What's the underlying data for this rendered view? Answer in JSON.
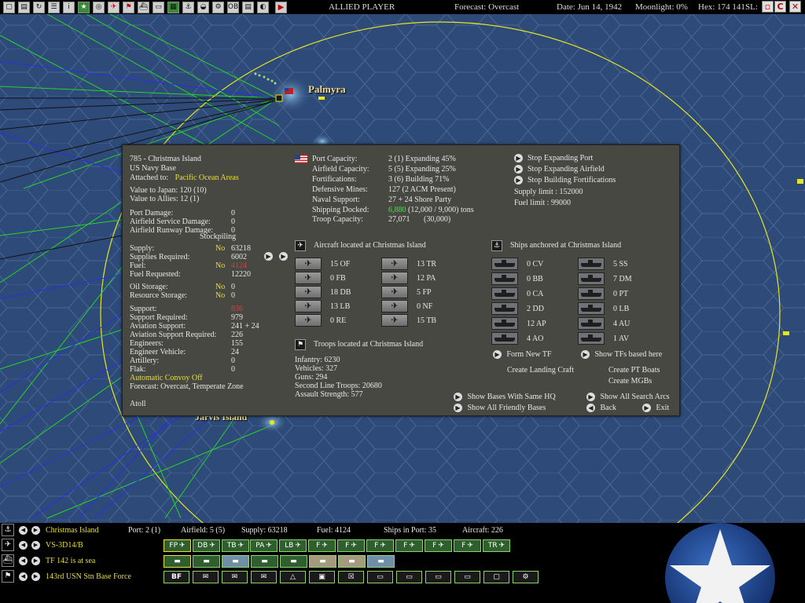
{
  "topbar": {
    "icons": [
      "square-icon",
      "doc-icon",
      "refresh-icon",
      "list-icon",
      "info-icon",
      "star-icon",
      "globe-icon",
      "plane-icon",
      "flag-icon",
      "ship-icon",
      "truck-icon",
      "map-icon",
      "harbor-icon",
      "submarine-icon",
      "settings-icon",
      "ob-icon",
      "page-icon",
      "moon-icon"
    ],
    "title": "ALLIED PLAYER",
    "forecast": "Forecast: Overcast",
    "date": "Date: Jun 14, 1942",
    "moonlight": "Moonlight: 0%",
    "hex": "Hex: 174 141",
    "sl": "SL:"
  },
  "map": {
    "labels": {
      "palmyra": "Palmyra",
      "jarvis": "Jarvis Island"
    },
    "colors": {
      "ocean": "#2d4a78",
      "hex_line": "#4a6794",
      "range_circle": "#e6e61e",
      "green_line": "#28d428",
      "blue_line": "#2830e6"
    }
  },
  "panel": {
    "header": {
      "name": "785 - Christmas Island",
      "type": "US Navy Base",
      "attached_label": "Attached to:",
      "attached_value": "Pacific Ocean Areas",
      "value_japan": "Value to Japan: 120 (10)",
      "value_allies": "Value to Allies: 12 (1)"
    },
    "damage": [
      {
        "label": "Port Damage:",
        "value": "0"
      },
      {
        "label": "Airfield Service Damage:",
        "value": "0"
      },
      {
        "label": "Airfield Runway Damage:",
        "value": "0"
      }
    ],
    "stockpiling": "Stockpiling",
    "supply": [
      {
        "label": "Supply:",
        "flag": "No",
        "value": "63218",
        "value_color": ""
      },
      {
        "label": "Supplies Required:",
        "flag": "",
        "value": "6002",
        "value_color": ""
      },
      {
        "label": "Fuel:",
        "flag": "No",
        "value": "4124",
        "value_color": "red"
      },
      {
        "label": "Fuel Requested:",
        "flag": "",
        "value": "12220",
        "value_color": ""
      }
    ],
    "storage": [
      {
        "label": "Oil Storage:",
        "flag": "No",
        "value": "0"
      },
      {
        "label": "Resource Storage:",
        "flag": "No",
        "value": "0"
      }
    ],
    "support": [
      {
        "label": "Support:",
        "value": "836",
        "value_color": "red"
      },
      {
        "label": "Support Required:",
        "value": "979",
        "value_color": ""
      },
      {
        "label": "Aviation Support:",
        "value": "241 + 24",
        "value_color": ""
      },
      {
        "label": "Aviation Support Required:",
        "value": "226",
        "value_color": ""
      },
      {
        "label": "Engineers:",
        "value": "155",
        "value_color": ""
      },
      {
        "label": "Engineer Vehicle:",
        "value": "24",
        "value_color": ""
      },
      {
        "label": "Artillery:",
        "value": "0",
        "value_color": ""
      },
      {
        "label": "Flak:",
        "value": "0",
        "value_color": ""
      }
    ],
    "convoy": "Automatic Convoy Off",
    "forecast": "Forecast: Overcast, Temperate Zone",
    "terrain": "Atoll",
    "capacity": [
      {
        "label": "Port Capacity:",
        "value": "2 (1) Expanding 45%"
      },
      {
        "label": "Airfield Capacity:",
        "value": "5 (5) Expanding 25%"
      },
      {
        "label": "Fortifications:",
        "value": "3 (6) Building 71%"
      },
      {
        "label": "Defensive Mines:",
        "value": "127 (2 ACM Present)"
      },
      {
        "label": "Naval Support:",
        "value": "27 + 24 Shore Party"
      }
    ],
    "shipping_docked": {
      "label": "Shipping Docked:",
      "value_green": "6,880",
      "value_rest": "(12,000 / 9,000) tons"
    },
    "troop_capacity": {
      "label": "Troop Capacity:",
      "value": "27,071",
      "value2": "(30,000)"
    },
    "actions": [
      "Stop Expanding Port",
      "Stop Expanding Airfield",
      "Stop Building Fortifications"
    ],
    "supply_limit": "Supply limit : 152000",
    "fuel_limit": "Fuel limit : 99000",
    "aircraft_title": "Aircraft located at Christmas Island",
    "aircraft_left": [
      "15 OF",
      "0 FB",
      "18 DB",
      "13 LB",
      "0 RE"
    ],
    "aircraft_right": [
      "13 TR",
      "12 PA",
      "5 FP",
      "0 NF",
      "15 TB"
    ],
    "ships_title": "Ships anchored at Christmas Island",
    "ships_left": [
      "0 CV",
      "0 BB",
      "0 CA",
      "2 DD",
      "12 AP",
      "4 AO"
    ],
    "ships_right": [
      "5 SS",
      "7 DM",
      "0 PT",
      "0 LB",
      "4 AU",
      "1 AV"
    ],
    "form_tf": "Form New TF",
    "show_tfs": "Show TFs based here",
    "create_landing": "Create Landing Craft",
    "create_pt": "Create PT Boats",
    "create_mgb": "Create MGBs",
    "troops_title": "Troops located at Christmas Island",
    "troops": [
      "Infantry: 6230",
      "Vehicles: 327",
      "Guns: 294",
      "Second Line Troops: 20680",
      "Assault Strength: 577"
    ],
    "bottom_actions": {
      "same_hq": "Show Bases With Same HQ",
      "friendly": "Show All Friendly Bases",
      "search_arcs": "Show All Search Arcs",
      "back": "Back",
      "exit": "Exit"
    }
  },
  "bottom": {
    "base": {
      "name": "Christmas Island",
      "port": "Port: 2 (1)",
      "airfield": "Airfield: 5 (5)",
      "supply": "Supply: 63218",
      "fuel": "Fuel: 4124",
      "ships": "Ships in Port: 35",
      "aircraft": "Aircraft: 226"
    },
    "air_unit": "VS-3D14/B",
    "tf": "TF 142 is at sea",
    "ground": "143rd USN Stn Base Force",
    "air_buttons": [
      "FP",
      "DB",
      "TB",
      "PA",
      "LB",
      "F",
      "F",
      "F",
      "F",
      "F",
      "F",
      "TR"
    ],
    "ground_first": "BF"
  }
}
